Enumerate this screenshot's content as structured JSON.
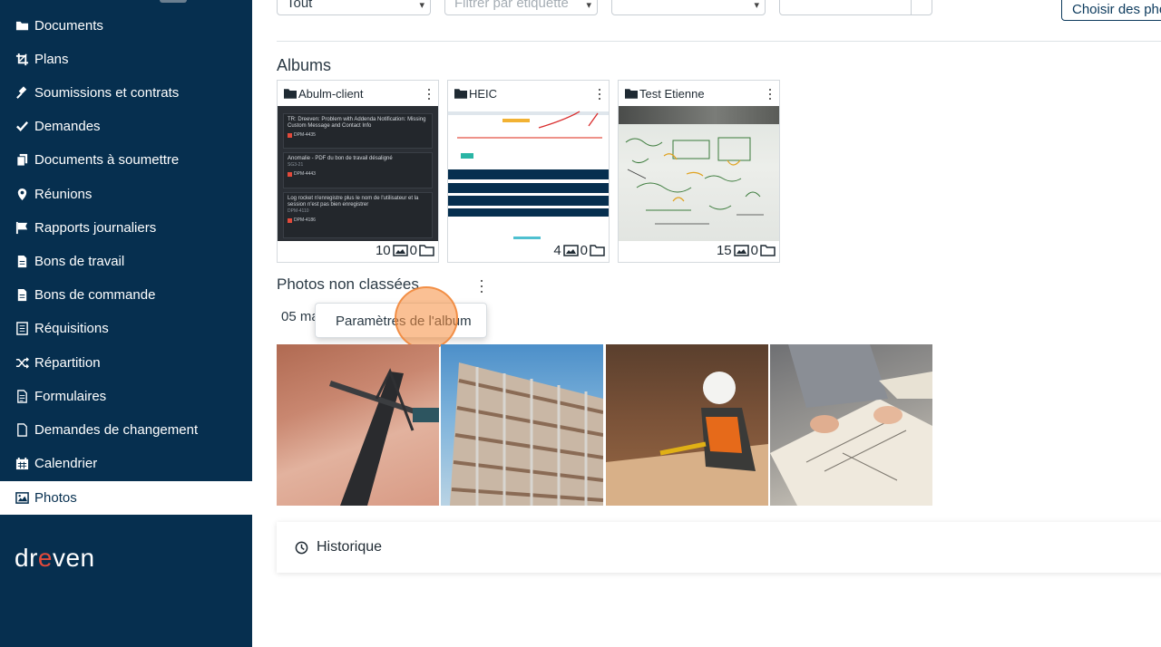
{
  "sidebar": {
    "items": [
      {
        "label": "Documents",
        "icon": "folder-icon"
      },
      {
        "label": "Plans",
        "icon": "crop-icon"
      },
      {
        "label": "Soumissions et contrats",
        "icon": "gavel-icon"
      },
      {
        "label": "Demandes",
        "icon": "check-icon"
      },
      {
        "label": "Documents à soumettre",
        "icon": "copy-icon"
      },
      {
        "label": "Réunions",
        "icon": "map-pin-icon"
      },
      {
        "label": "Rapports journaliers",
        "icon": "flag-icon"
      },
      {
        "label": "Bons de travail",
        "icon": "file-text-icon"
      },
      {
        "label": "Bons de commande",
        "icon": "file-text-icon"
      },
      {
        "label": "Réquisitions",
        "icon": "checklist-icon"
      },
      {
        "label": "Répartition",
        "icon": "shuffle-icon"
      },
      {
        "label": "Formulaires",
        "icon": "file-lines-icon"
      },
      {
        "label": "Demandes de changement",
        "icon": "file-outline-icon"
      },
      {
        "label": "Calendrier",
        "icon": "calendar-icon"
      },
      {
        "label": "Photos",
        "icon": "image-icon",
        "active": true
      }
    ],
    "logo_text_left": "dr",
    "logo_text_right": "ven"
  },
  "filters": {
    "type_value": "Tout",
    "tag_placeholder": "Filtrer par étiquette",
    "third_value": "",
    "search_value": ""
  },
  "choose_photos_label": "Choisir des pho",
  "albums_title": "Albums",
  "albums": [
    {
      "name": "Abulm-client",
      "photos": "10",
      "folders": "0",
      "thumb_cards": [
        {
          "title": "TR: Dreeven: Problem with Addenda Notification: Missing Custom Message and Contact Info",
          "code": "DPM-4435"
        },
        {
          "title": "Anomalie - PDF du bon de travail désaligné",
          "sub": "SG3-21",
          "code": "DPM-4443"
        },
        {
          "title": "Log rocket n'enregistre plus le nom de l'utilisateur et la session n'est pas bien enregistrer",
          "sub": "DPM-4110",
          "code": "DPM-4186"
        }
      ]
    },
    {
      "name": "HEIC",
      "photos": "4",
      "folders": "0"
    },
    {
      "name": "Test Etienne",
      "photos": "15",
      "folders": "0"
    }
  ],
  "unsorted": {
    "title": "Photos non classées",
    "date_label": "05 ma",
    "menu_option": "Paramètres de l'album"
  },
  "history_label": "Historique",
  "colors": {
    "sidebar_bg": "#062f4f",
    "accent_orange": "#f58c3c",
    "logo_red": "#e24a3b"
  }
}
